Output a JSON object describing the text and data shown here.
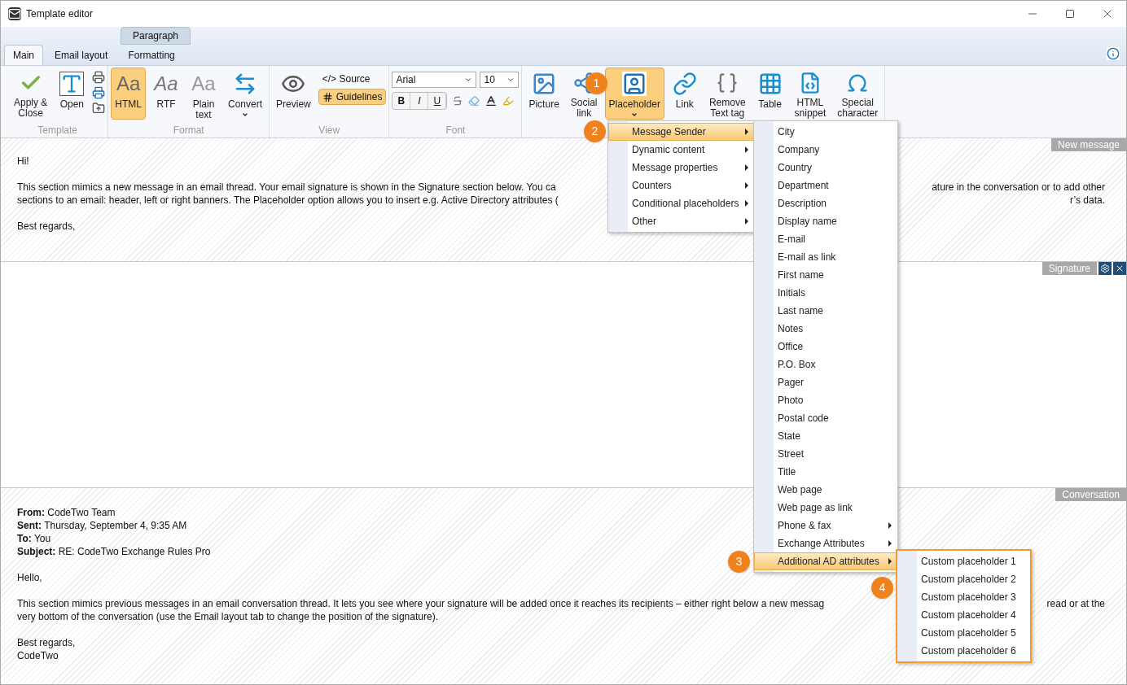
{
  "window": {
    "title": "Template editor"
  },
  "context_tab": "Paragraph",
  "tabs": [
    {
      "label": "Main",
      "selected": true
    },
    {
      "label": "Email layout",
      "selected": false
    },
    {
      "label": "Formatting",
      "selected": false
    }
  ],
  "ribbon": {
    "groups": [
      {
        "label": "Template",
        "buttons": [
          {
            "kind": "apply",
            "label": "Apply &\nClose",
            "selected": false
          },
          {
            "kind": "open",
            "label": "Open",
            "selected": false
          },
          {
            "kind": "small-stack"
          }
        ]
      },
      {
        "label": "Format",
        "buttons": [
          {
            "kind": "glyph",
            "glyph": "Aa",
            "label": "HTML",
            "selected": true
          },
          {
            "kind": "glyph",
            "glyph": "Aa",
            "label": "RTF",
            "selected": false
          },
          {
            "kind": "glyph",
            "glyph": "Aa",
            "label": "Plain\ntext",
            "selected": false
          },
          {
            "kind": "convert",
            "label": "Convert",
            "dropdown": true,
            "selected": false
          }
        ]
      },
      {
        "label": "View",
        "buttons": [
          {
            "kind": "preview",
            "label": "Preview",
            "selected": false
          },
          {
            "kind": "view-pair",
            "items": [
              {
                "glyph": "</>",
                "label": "Source",
                "selected": false
              },
              {
                "label": "Guidelines",
                "selected": true
              }
            ]
          }
        ]
      },
      {
        "label": "Font",
        "buttons": [
          {
            "kind": "font",
            "font": "Arial",
            "size": "10",
            "format": [
              "B",
              "I",
              "U"
            ]
          }
        ]
      },
      {
        "buttons": [
          {
            "kind": "picture",
            "label": "Picture",
            "selected": false
          },
          {
            "kind": "social",
            "label": "Social\nlink",
            "selected": false
          },
          {
            "kind": "placeholder",
            "label": "Placeholder",
            "dropdown": true,
            "selected": true
          },
          {
            "kind": "link",
            "label": "Link",
            "selected": false
          },
          {
            "kind": "rt",
            "label": "Remove\nText tag",
            "selected": false
          },
          {
            "kind": "table",
            "label": "Table",
            "selected": false
          },
          {
            "kind": "snippet",
            "label": "HTML\nsnippet",
            "selected": false
          },
          {
            "kind": "omega",
            "label": "Special\ncharacter",
            "selected": false
          }
        ]
      }
    ]
  },
  "new_message": {
    "tag": "New message",
    "greeting": "Hi!",
    "lines": [
      {
        "left": "This section mimics a new message in an email thread. Your email signature is shown in the Signature section below. You ca",
        "right": "ature in the conversation or to add other"
      },
      {
        "left": "sections to an email: header, left or right banners. The Placeholder option allows you to insert e.g. Active Directory attributes (",
        "right": "r’s data."
      }
    ],
    "closing": "Best regards,"
  },
  "signature": {
    "tag": "Signature"
  },
  "conversation": {
    "tag": "Conversation",
    "headers": [
      {
        "label": "From:",
        "value": "CodeTwo Team"
      },
      {
        "label": "Sent:",
        "value": "Thursday, September 4, 9:35 AM"
      },
      {
        "label": "To:",
        "value": "You"
      },
      {
        "label": "Subject:",
        "value": "RE: CodeTwo Exchange Rules Pro"
      }
    ],
    "greeting": "Hello,",
    "lines": [
      {
        "left": "This section mimics previous messages in an email conversation thread. It lets you see where your signature will be added once it reaches its recipients – either right below a new messag",
        "right": "read or at the"
      },
      {
        "left": "very bottom of the conversation (use the Email layout tab to change the position of the signature)."
      }
    ],
    "closing": [
      "Best regards,",
      "CodeTwo"
    ]
  },
  "menus": [
    {
      "items": [
        {
          "label": "Message Sender",
          "submenu": true,
          "selected": true
        },
        {
          "label": "Dynamic content",
          "submenu": true,
          "selected": false
        },
        {
          "label": "Message properties",
          "submenu": true,
          "selected": false
        },
        {
          "label": "Counters",
          "submenu": true,
          "selected": false
        },
        {
          "label": "Conditional placeholders",
          "submenu": true,
          "selected": false
        },
        {
          "label": "Other",
          "submenu": true,
          "selected": false
        }
      ]
    },
    {
      "items": [
        {
          "label": "City",
          "submenu": false,
          "selected": false
        },
        {
          "label": "Company",
          "submenu": false,
          "selected": false
        },
        {
          "label": "Country",
          "submenu": false,
          "selected": false
        },
        {
          "label": "Department",
          "submenu": false,
          "selected": false
        },
        {
          "label": "Description",
          "submenu": false,
          "selected": false
        },
        {
          "label": "Display name",
          "submenu": false,
          "selected": false
        },
        {
          "label": "E-mail",
          "submenu": false,
          "selected": false
        },
        {
          "label": "E-mail as link",
          "submenu": false,
          "selected": false
        },
        {
          "label": "First name",
          "submenu": false,
          "selected": false
        },
        {
          "label": "Initials",
          "submenu": false,
          "selected": false
        },
        {
          "label": "Last name",
          "submenu": false,
          "selected": false
        },
        {
          "label": "Notes",
          "submenu": false,
          "selected": false
        },
        {
          "label": "Office",
          "submenu": false,
          "selected": false
        },
        {
          "label": "P.O. Box",
          "submenu": false,
          "selected": false
        },
        {
          "label": "Pager",
          "submenu": false,
          "selected": false
        },
        {
          "label": "Photo",
          "submenu": false,
          "selected": false
        },
        {
          "label": "Postal code",
          "submenu": false,
          "selected": false
        },
        {
          "label": "State",
          "submenu": false,
          "selected": false
        },
        {
          "label": "Street",
          "submenu": false,
          "selected": false
        },
        {
          "label": "Title",
          "submenu": false,
          "selected": false
        },
        {
          "label": "Web page",
          "submenu": false,
          "selected": false
        },
        {
          "label": "Web page as link",
          "submenu": false,
          "selected": false
        },
        {
          "label": "Phone & fax",
          "submenu": true,
          "selected": false
        },
        {
          "label": "Exchange Attributes",
          "submenu": true,
          "selected": false
        },
        {
          "label": "Additional AD attributes",
          "submenu": true,
          "selected": true
        }
      ]
    },
    {
      "highlighted": true,
      "items": [
        {
          "label": "Custom placeholder 1",
          "submenu": false,
          "selected": false
        },
        {
          "label": "Custom placeholder 2",
          "submenu": false,
          "selected": false
        },
        {
          "label": "Custom placeholder 3",
          "submenu": false,
          "selected": false
        },
        {
          "label": "Custom placeholder 4",
          "submenu": false,
          "selected": false
        },
        {
          "label": "Custom placeholder 5",
          "submenu": false,
          "selected": false
        },
        {
          "label": "Custom placeholder 6",
          "submenu": false,
          "selected": false
        }
      ]
    }
  ],
  "callouts": [
    "1",
    "2",
    "3",
    "4"
  ]
}
